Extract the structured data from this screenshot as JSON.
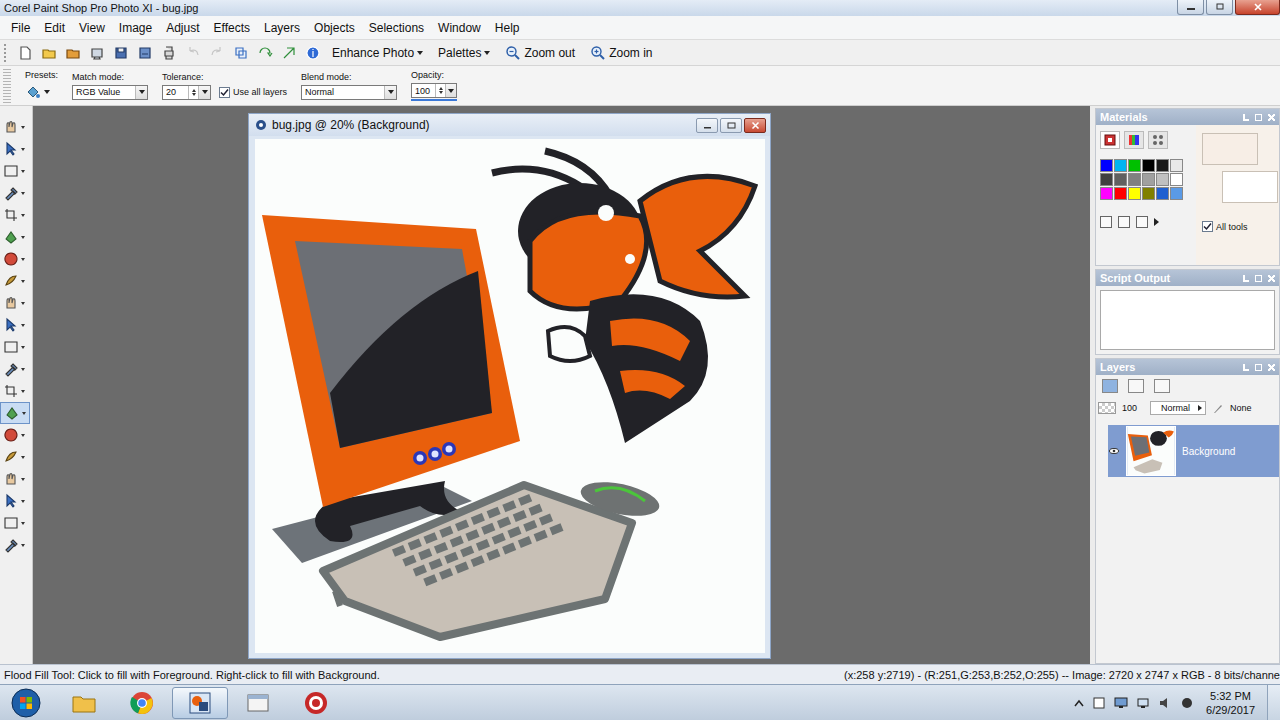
{
  "window": {
    "title": "Corel Paint Shop Pro Photo XI - bug.jpg"
  },
  "menu": [
    "File",
    "Edit",
    "View",
    "Image",
    "Adjust",
    "Effects",
    "Layers",
    "Objects",
    "Selections",
    "Window",
    "Help"
  ],
  "toolbar": {
    "icon_buttons": [
      {
        "disabled": false
      },
      {
        "disabled": false
      },
      {
        "disabled": false
      },
      {
        "disabled": false
      },
      {
        "disabled": false
      },
      {
        "disabled": false
      },
      {
        "disabled": false
      },
      {
        "disabled": true
      },
      {
        "disabled": true
      },
      {
        "disabled": false
      },
      {
        "disabled": false
      },
      {
        "disabled": false
      },
      {
        "disabled": false
      }
    ],
    "buttons": [
      {
        "label": "Enhance Photo",
        "dropdown": true,
        "kind": "text"
      },
      {
        "label": "Palettes",
        "dropdown": true,
        "kind": "text"
      },
      {
        "label": "Zoom out",
        "dropdown": false,
        "kind": "zoom-out"
      },
      {
        "label": "Zoom in",
        "dropdown": false,
        "kind": "zoom-in"
      }
    ]
  },
  "options": {
    "presets": {
      "label": "Presets:"
    },
    "match_mode": {
      "label": "Match mode:",
      "value": "RGB Value"
    },
    "tolerance": {
      "label": "Tolerance:",
      "value": "20"
    },
    "use_all_layers": {
      "label": "Use all layers",
      "checked": true
    },
    "blend_mode": {
      "label": "Blend mode:",
      "value": "Normal"
    },
    "opacity": {
      "label": "Opacity:",
      "value": "100",
      "level": 1
    }
  },
  "tools": [
    {
      "selected": false
    },
    {
      "selected": false
    },
    {
      "selected": false
    },
    {
      "selected": false
    },
    {
      "selected": false
    },
    {
      "selected": false
    },
    {
      "selected": false
    },
    {
      "selected": false
    },
    {
      "selected": false
    },
    {
      "selected": false
    },
    {
      "selected": false
    },
    {
      "selected": false
    },
    {
      "selected": false
    },
    {
      "selected": true
    },
    {
      "selected": false
    },
    {
      "selected": false
    },
    {
      "selected": false
    },
    {
      "selected": false
    },
    {
      "selected": false
    },
    {
      "selected": false
    }
  ],
  "document": {
    "title": "bug.jpg @ 20% (Background)"
  },
  "materials": {
    "title": "Materials",
    "swatches": [
      {
        "color": "#0000ff"
      },
      {
        "color": "#00b4f0"
      },
      {
        "color": "#00c000"
      },
      {
        "color": "#000000"
      },
      {
        "color": "#1a1a1a"
      },
      {
        "color": "#e8e8e8"
      },
      {
        "color": "#404040"
      },
      {
        "color": "#606060"
      },
      {
        "color": "#808080"
      },
      {
        "color": "#a0a0a0"
      },
      {
        "color": "#c0c0c0"
      },
      {
        "color": "#ffffff"
      },
      {
        "color": "#ff00ff"
      },
      {
        "color": "#ff0000"
      },
      {
        "color": "#ffff00"
      },
      {
        "color": "#808000"
      },
      {
        "color": "#1f5fd0"
      },
      {
        "color": "#5a9ae6"
      }
    ],
    "foreground": "#f7eee6",
    "background": "#ffffff",
    "all_tools": {
      "label": "All tools",
      "checked": true
    }
  },
  "script_output": {
    "title": "Script Output"
  },
  "layers": {
    "title": "Layers",
    "opacity": "100",
    "blend_mode": "Normal",
    "mask": "None",
    "items": [
      {
        "name": "Background",
        "selected": true,
        "visible": true
      }
    ]
  },
  "status_bar": {
    "hint": "Flood Fill Tool: Click to fill with Foreground. Right-click to fill with Background.",
    "info": "(x:258 y:2719) - (R:251,G:253,B:252,O:255) -- Image: 2720 x 2747 x RGB - 8 bits/channe"
  },
  "taskbar": {
    "apps": [
      {
        "selected": false
      },
      {
        "selected": false
      },
      {
        "selected": true
      },
      {
        "selected": false
      },
      {
        "selected": false
      }
    ],
    "time": "5:32 PM",
    "date": "6/29/2017"
  }
}
